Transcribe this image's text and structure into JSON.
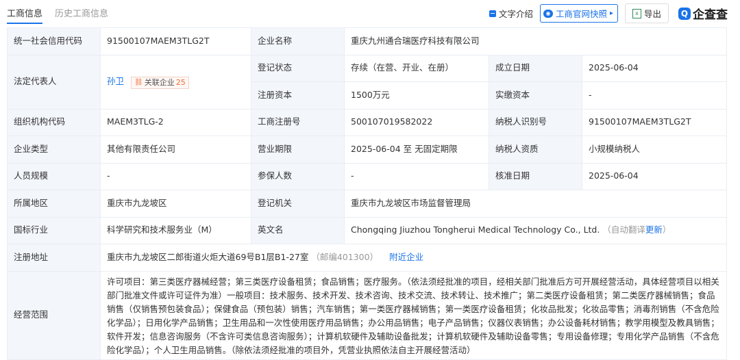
{
  "tabs": [
    "工商信息",
    "历史工商信息"
  ],
  "actions": {
    "text_intro": "文字介绍",
    "official": "工商官网快照",
    "export": "导出",
    "logo": "企查查"
  },
  "company": {
    "credit_code_label": "统一社会信用代码",
    "credit_code": "91500107MAEM3TLG2T",
    "name_label": "企业名称",
    "name": "重庆九州通合瑞医疗科技有限公司",
    "legal_rep_label": "法定代表人",
    "legal_rep": "孙卫",
    "related_label": "关联企业",
    "related_count": "25",
    "status_label": "登记状态",
    "status": "存续（在营、开业、在册）",
    "found_label": "成立日期",
    "found_date": "2025-06-04",
    "reg_capital_label": "注册资本",
    "reg_capital": "1500万元",
    "paid_capital_label": "实缴资本",
    "paid_capital": "-",
    "org_code_label": "组织机构代码",
    "org_code": "MAEM3TLG-2",
    "reg_no_label": "工商注册号",
    "reg_no": "500107019582022",
    "taxpayer_id_label": "纳税人识别号",
    "taxpayer_id": "91500107MAEM3TLG2T",
    "type_label": "企业类型",
    "type": "其他有限责任公司",
    "term_label": "营业期限",
    "term": "2025-06-04 至 无固定期限",
    "tax_qual_label": "纳税人资质",
    "tax_qual": "小规模纳税人",
    "staff_label": "人员规模",
    "staff": "-",
    "insured_label": "参保人数",
    "insured": "-",
    "approve_label": "核准日期",
    "approve_date": "2025-06-04",
    "region_label": "所属地区",
    "region": "重庆市九龙坡区",
    "authority_label": "登记机关",
    "authority": "重庆市九龙坡区市场监督管理局",
    "industry_label": "国标行业",
    "industry": "科学研究和技术服务业（M）",
    "en_name_label": "英文名",
    "en_name": "Chongqing Jiuzhou Tongherui Medical Technology Co., Ltd.",
    "auto_translate": "（自动翻译",
    "update_link": "更新",
    "auto_translate_end": "）",
    "address_label": "注册地址",
    "address": "重庆市九龙坡区二郎街道火炬大道69号B1层B1-27室",
    "postcode": "（邮编401300）",
    "nearby_link": "附近企业",
    "scope_label": "经营范围",
    "scope": "许可项目：第三类医疗器械经营；第三类医疗设备租赁；食品销售；医疗服务。（依法须经批准的项目，经相关部门批准后方可开展经营活动，具体经营项目以相关部门批准文件或许可证件为准）一般项目：技术服务、技术开发、技术咨询、技术交流、技术转让、技术推广；第二类医疗设备租赁；第二类医疗器械销售；食品销售（仅销售预包装食品）；保健食品（预包装）销售；汽车销售；第一类医疗器械销售；第一类医疗设备租赁；化妆品批发；化妆品零售；消毒剂销售（不含危险化学品）；日用化学产品销售；卫生用品和一次性使用医疗用品销售；办公用品销售；电子产品销售；仪器仪表销售；办公设备耗材销售；教学用模型及教具销售；软件开发；信息咨询服务（不含许可类信息咨询服务）；计算机软硬件及辅助设备批发；计算机软硬件及辅助设备零售；专用设备修理；专用化学产品销售（不含危险化学品）；个人卫生用品销售。（除依法须经批准的项目外，凭营业执照依法自主开展经营活动）"
  }
}
